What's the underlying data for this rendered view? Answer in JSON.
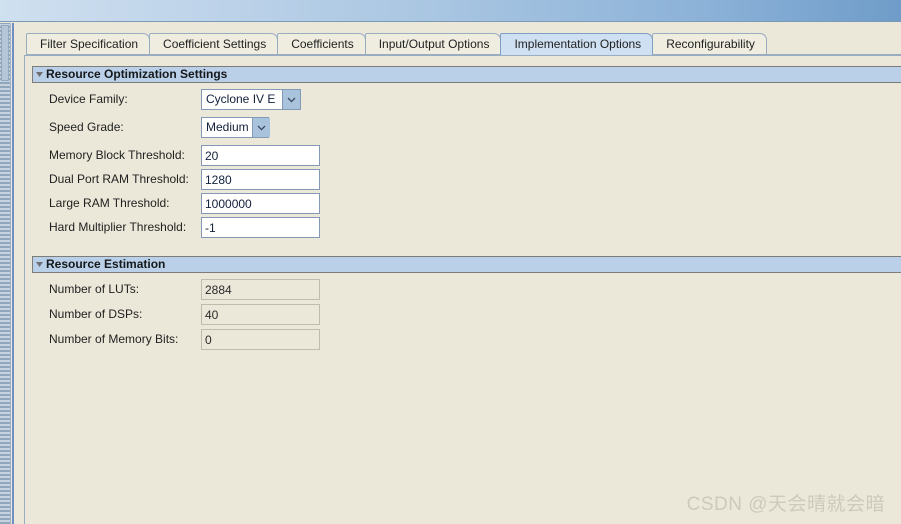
{
  "window": {
    "titlebar_gradient_left": "#cfe0ef",
    "titlebar_gradient_right": "#6f9cc9"
  },
  "tabs": [
    {
      "label": "Filter Specification",
      "selected": false
    },
    {
      "label": "Coefficient Settings",
      "selected": false
    },
    {
      "label": "Coefficients",
      "selected": false
    },
    {
      "label": "Input/Output Options",
      "selected": false
    },
    {
      "label": "Implementation Options",
      "selected": true
    },
    {
      "label": "Reconfigurability",
      "selected": false
    }
  ],
  "sections": [
    {
      "title": "Resource Optimization Settings",
      "toggle_icon": "triangle-down-icon",
      "fields": [
        {
          "label": "Device Family:",
          "value": "Cyclone IV E",
          "type": "combo",
          "width": 100
        },
        {
          "label": "Speed Grade:",
          "value": "Medium",
          "type": "combo",
          "width": 68
        },
        {
          "label": "Memory Block Threshold:",
          "value": "20",
          "type": "text"
        },
        {
          "label": "Dual Port RAM Threshold:",
          "value": "1280",
          "type": "text"
        },
        {
          "label": "Large RAM Threshold:",
          "value": "1000000",
          "type": "text"
        },
        {
          "label": "Hard Multiplier Threshold:",
          "value": "-1",
          "type": "text"
        }
      ]
    },
    {
      "title": "Resource Estimation",
      "toggle_icon": "triangle-down-icon",
      "fields": [
        {
          "label": "Number of LUTs:",
          "value": "2884",
          "type": "text-readonly"
        },
        {
          "label": "Number of DSPs:",
          "value": "40",
          "type": "text-readonly"
        },
        {
          "label": "Number of Memory Bits:",
          "value": "0",
          "type": "text-readonly"
        }
      ]
    }
  ],
  "watermark": {
    "text": "CSDN @天会晴就会暗"
  },
  "colors": {
    "panel_background": "#ebe8d9",
    "section_header": "#b9d0e8",
    "selected_tab": "#cfe0f2",
    "input_border": "#8399b5",
    "combo_arrow": "#a9c3dd"
  }
}
